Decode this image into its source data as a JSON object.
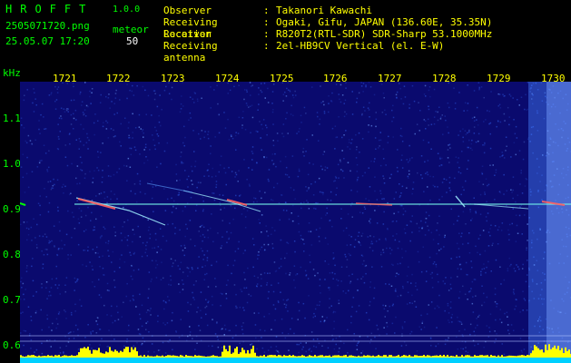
{
  "app": {
    "title": "HROFFT",
    "version": "1.0.0",
    "file_name": "2505071720.png",
    "timestamp": "25.05.07 17:20",
    "meteor_label": "meteor",
    "meteor_count": "50"
  },
  "info": [
    {
      "label": "Observer",
      "value": "Takanori Kawachi"
    },
    {
      "label": "Receiving Location",
      "value": "Ogaki, Gifu, JAPAN (136.60E, 35.35N)"
    },
    {
      "label": "Receiver",
      "value": "R820T2(RTL-SDR) SDR-Sharp 53.1000MHz"
    },
    {
      "label": "Receiving antenna",
      "value": "2el-HB9CV Vertical (el. E-W)"
    }
  ],
  "axis": {
    "unit": "kHz",
    "x_ticks": [
      "1721",
      "1722",
      "1723",
      "1724",
      "1725",
      "1726",
      "1727",
      "1728",
      "1729",
      "1730"
    ],
    "y_ticks": [
      "1.1",
      "1.0",
      "0.9",
      "0.8",
      "0.7",
      "0.6"
    ]
  },
  "colors": {
    "background": "#0a0a6e",
    "noise": "#2a52d8",
    "trace": "#70f0e8",
    "meteor_echo": "#ff6060",
    "histogram": "#ffff00",
    "header_green": "#00ff00",
    "header_yellow": "#ffff00"
  }
}
